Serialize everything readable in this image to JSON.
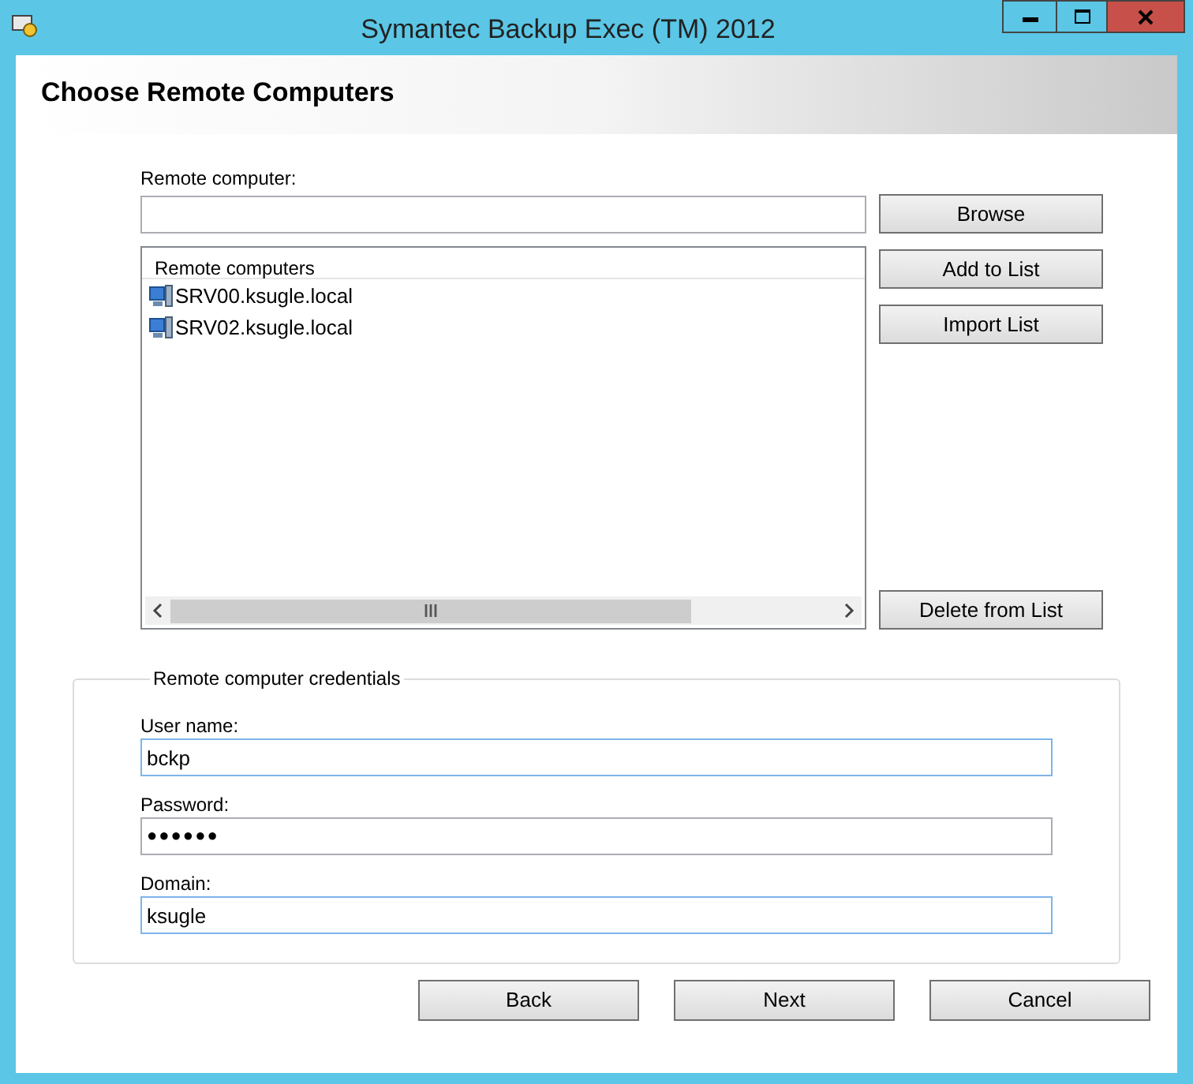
{
  "window": {
    "title": "Symantec Backup Exec (TM) 2012"
  },
  "header": {
    "title": "Choose Remote Computers"
  },
  "remote_computer": {
    "label": "Remote computer:"
  },
  "list": {
    "header": "Remote computers",
    "items": [
      {
        "name": "SRV00.ksugle.local",
        "selected": false
      },
      {
        "name": "SRV02.ksugle.local",
        "selected": false
      }
    ]
  },
  "side_buttons": [
    "Browse",
    "Add to List",
    "Import List",
    "Delete from List"
  ],
  "credentials": {
    "legend": "Remote computer credentials",
    "fields": [
      {
        "label": "User name:",
        "value": "bckp",
        "kind": "text"
      },
      {
        "label": "Password:",
        "value": "●●●●●●",
        "kind": "password"
      },
      {
        "label": "Domain:",
        "value": "ksugle",
        "kind": "text"
      }
    ]
  },
  "footer_buttons": [
    "Back",
    "Next",
    "Cancel"
  ]
}
